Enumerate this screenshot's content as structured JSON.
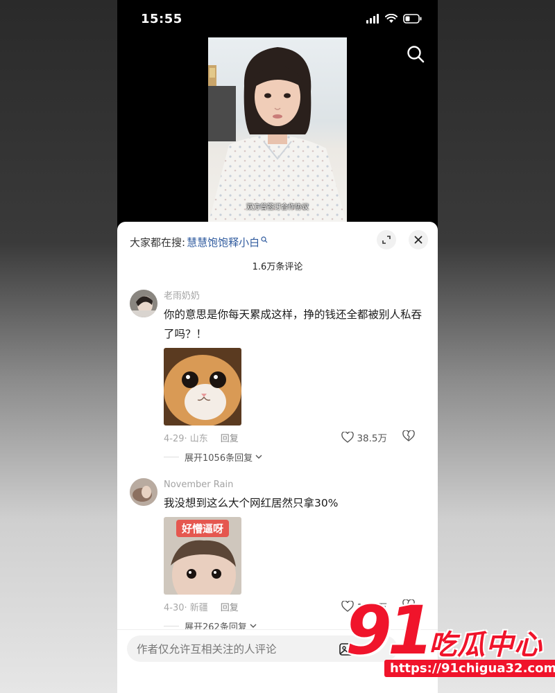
{
  "status_bar": {
    "time": "15:55"
  },
  "video": {
    "subtitle": "双方曾签订合作协议"
  },
  "sheet": {
    "search_prefix": "大家都在搜:",
    "search_term": "慧慧饱饱释小白",
    "comment_count": "1.6万条评论"
  },
  "comments": [
    {
      "username": "老雨奶奶",
      "text": "你的意思是你每天累成这样，挣的钱还全都被别人私吞了吗？！",
      "date_location": "4-29· 山东",
      "reply_label": "回复",
      "likes": "38.5万",
      "expand_label": "展开1056条回复"
    },
    {
      "username": "November Rain",
      "text": "我没想到这么大个网红居然只拿30%",
      "image_caption": "好懵逼呀",
      "date_location": "4-30· 新疆",
      "reply_label": "回复",
      "likes": "13.0万",
      "expand_label": "展开262条回复"
    }
  ],
  "input": {
    "placeholder": "作者仅允许互相关注的人评论"
  },
  "watermark": {
    "logo_number": "91",
    "logo_text": "吃瓜中心",
    "url": "https://91chigua32.com"
  },
  "colors": {
    "accent_blue": "#2e5a9e",
    "watermark_red": "#f0142b"
  }
}
